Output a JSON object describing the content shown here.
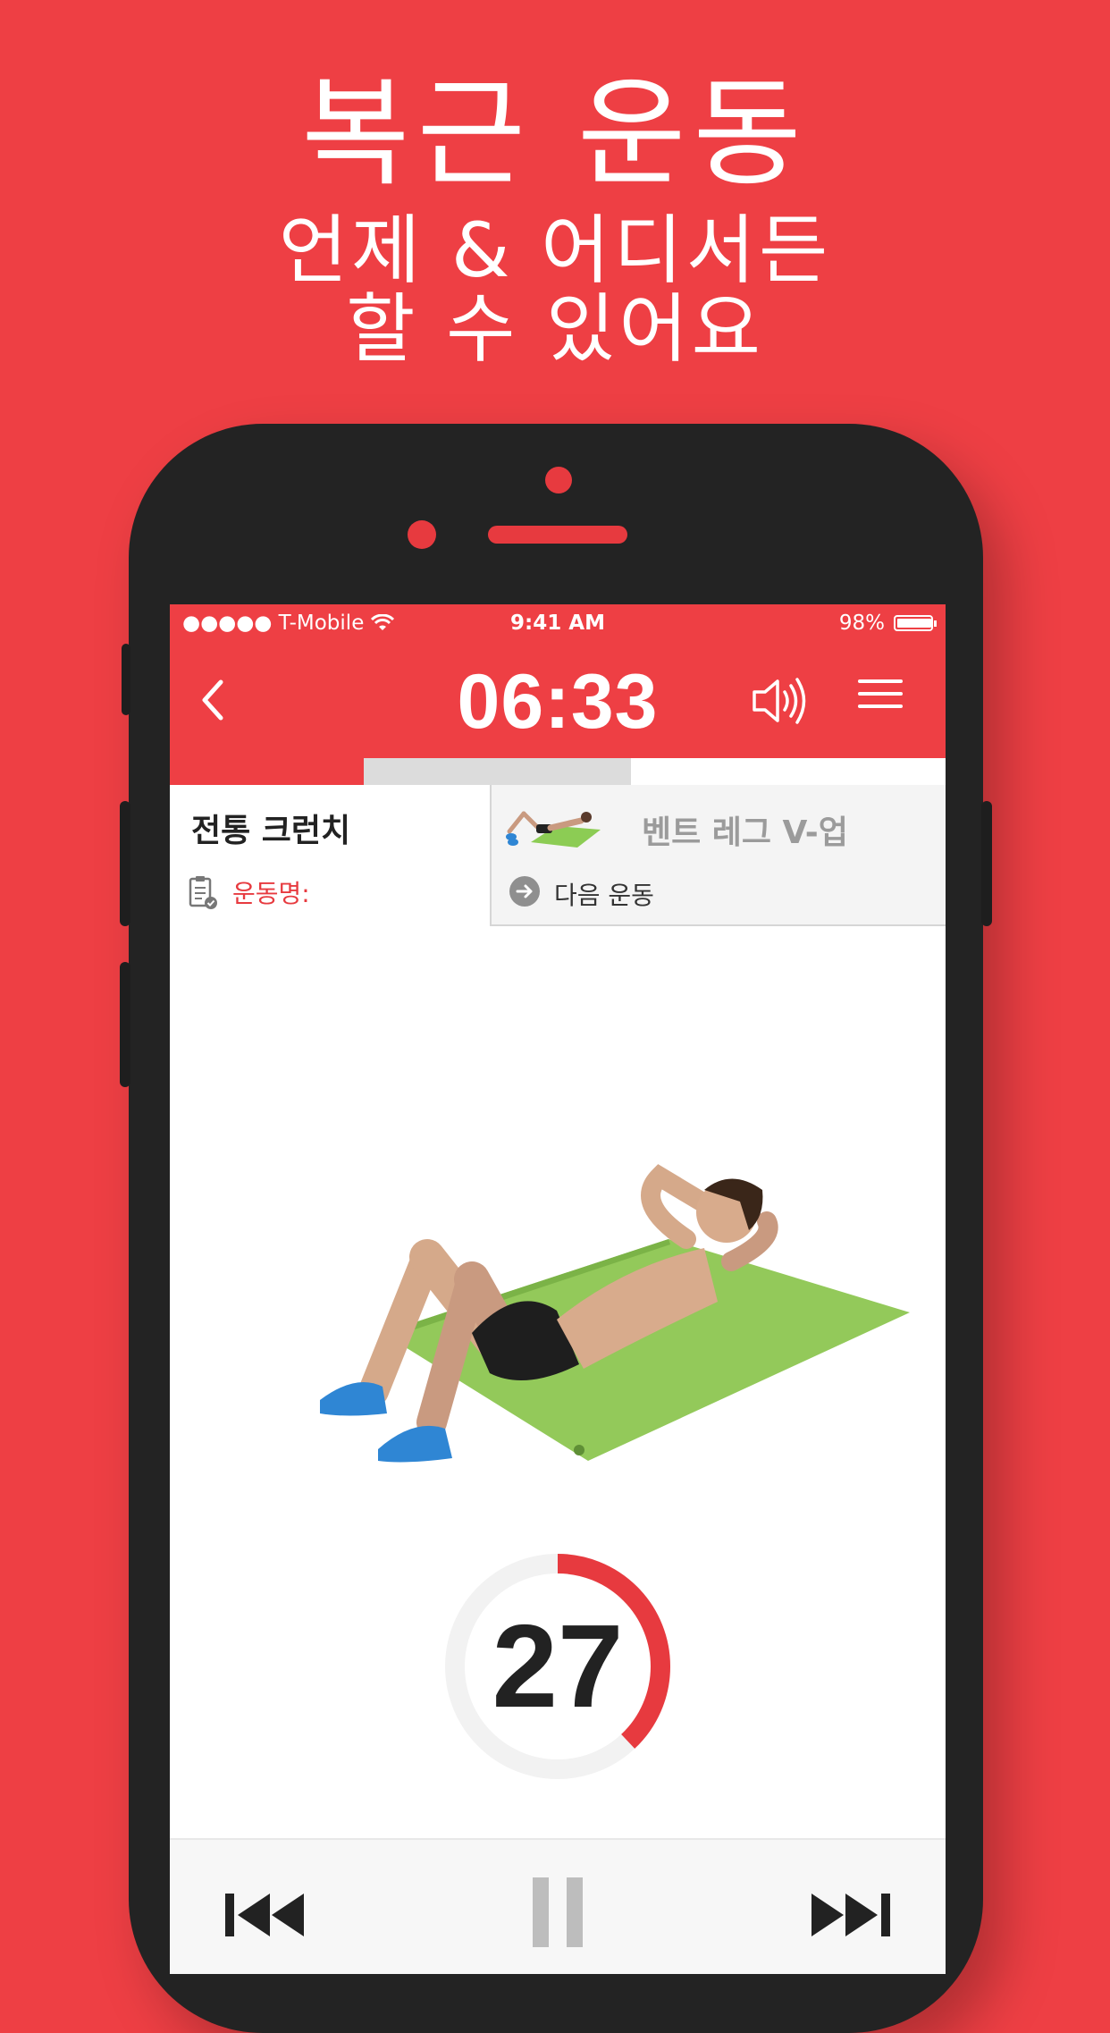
{
  "promo": {
    "title": "복근 운동",
    "line2": "언제 & 어디서든",
    "line3": "할 수 있어요"
  },
  "status_bar": {
    "carrier": "●●●●● T-Mobile",
    "time": "9:41 AM",
    "battery": "98%",
    "battery_level": 0.98
  },
  "nav": {
    "timer": "06:33",
    "back_icon": "chevron-left-icon",
    "sound_icon": "speaker-icon",
    "menu_icon": "hamburger-menu-icon"
  },
  "progress": {
    "completed_fraction": 0.25,
    "colors": {
      "done": "#ee3f44",
      "current": "#dcdcdc",
      "remaining": "#ffffff"
    }
  },
  "current_exercise": {
    "title": "전통 크런치",
    "label": "운동명:"
  },
  "next_exercise": {
    "title": "벤트 레그 V-업",
    "label": "다음 운동"
  },
  "counter": {
    "value": "27",
    "progress_fraction": 0.38,
    "color": "#e73a3f"
  },
  "controls": {
    "previous_icon": "skip-back-icon",
    "pause_icon": "pause-icon",
    "next_icon": "skip-forward-icon"
  },
  "colors": {
    "brand": "#ee3f44",
    "phone_body": "#232323"
  }
}
